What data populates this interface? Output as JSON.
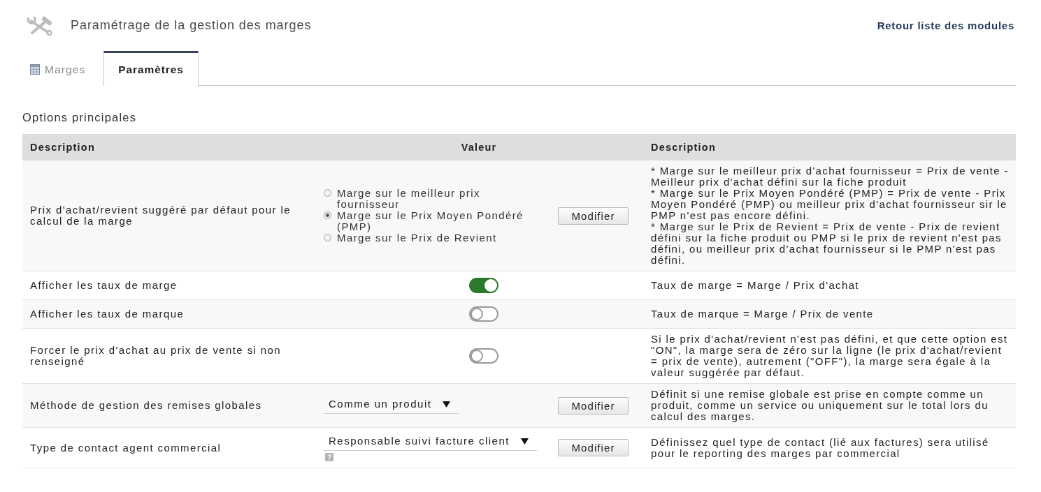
{
  "header": {
    "title": "Paramétrage de la gestion des marges",
    "link": "Retour liste des modules"
  },
  "tabs": [
    {
      "label": "Marges",
      "selected": false
    },
    {
      "label": "Paramètres",
      "selected": true
    }
  ],
  "section_title": "Options principales",
  "table": {
    "columns": [
      "Description",
      "Valeur",
      "Description"
    ],
    "rows": [
      {
        "description": "Prix d'achat/revient suggéré par défaut pour le calcul de la marge",
        "value": {
          "kind": "radio",
          "options": [
            {
              "label": "Marge sur le meilleur prix fournisseur",
              "selected": false
            },
            {
              "label": "Marge sur le Prix Moyen Pondéré (PMP)",
              "selected": true
            },
            {
              "label": "Marge sur le Prix de Revient",
              "selected": false
            }
          ]
        },
        "button": "Modifier",
        "note": "* Marge sur le meilleur prix d'achat fournisseur = Prix de vente - Meilleur prix d'achat défini sur la fiche produit\n* Marge sur le Prix Moyen Pondéré (PMP) = Prix de vente - Prix Moyen Pondéré (PMP) ou meilleur prix d'achat fournisseur sir le PMP n'est pas encore défini.\n* Marge sur le Prix de Revient = Prix de vente - Prix de revient défini sur la fiche produit ou PMP si le prix de revient n'est pas défini, ou meilleur prix d'achat fournisseur si le PMP n'est pas défini."
      },
      {
        "description": "Afficher les taux de marge",
        "value": {
          "kind": "toggle",
          "on": true
        },
        "note": "Taux de marge = Marge / Prix d'achat"
      },
      {
        "description": "Afficher les taux de marque",
        "value": {
          "kind": "toggle",
          "on": false
        },
        "note": "Taux de marque = Marge / Prix de vente"
      },
      {
        "description": "Forcer le prix d'achat au prix de vente si non renseigné",
        "value": {
          "kind": "toggle",
          "on": false
        },
        "note": "Si le prix d'achat/revient n'est pas défini, et que cette option est \"ON\", la marge sera de zéro sur la ligne (le prix d'achat/revient = prix de vente), autrement (\"OFF\"), la marge sera égale à la valeur suggérée par défaut."
      },
      {
        "description": "Méthode de gestion des remises globales",
        "value": {
          "kind": "select",
          "value": "Comme un produit"
        },
        "button": "Modifier",
        "note": "Définit si une remise globale est prise en compte comme un produit, comme un service ou uniquement sur le total lors du calcul des marges."
      },
      {
        "description": "Type de contact agent commercial",
        "value": {
          "kind": "select",
          "value": "Responsable suivi facture client",
          "help": true
        },
        "button": "Modifier",
        "note": "Définissez quel type de contact (lié aux factures) sera utilisé pour le reporting des marges par commercial"
      }
    ]
  }
}
